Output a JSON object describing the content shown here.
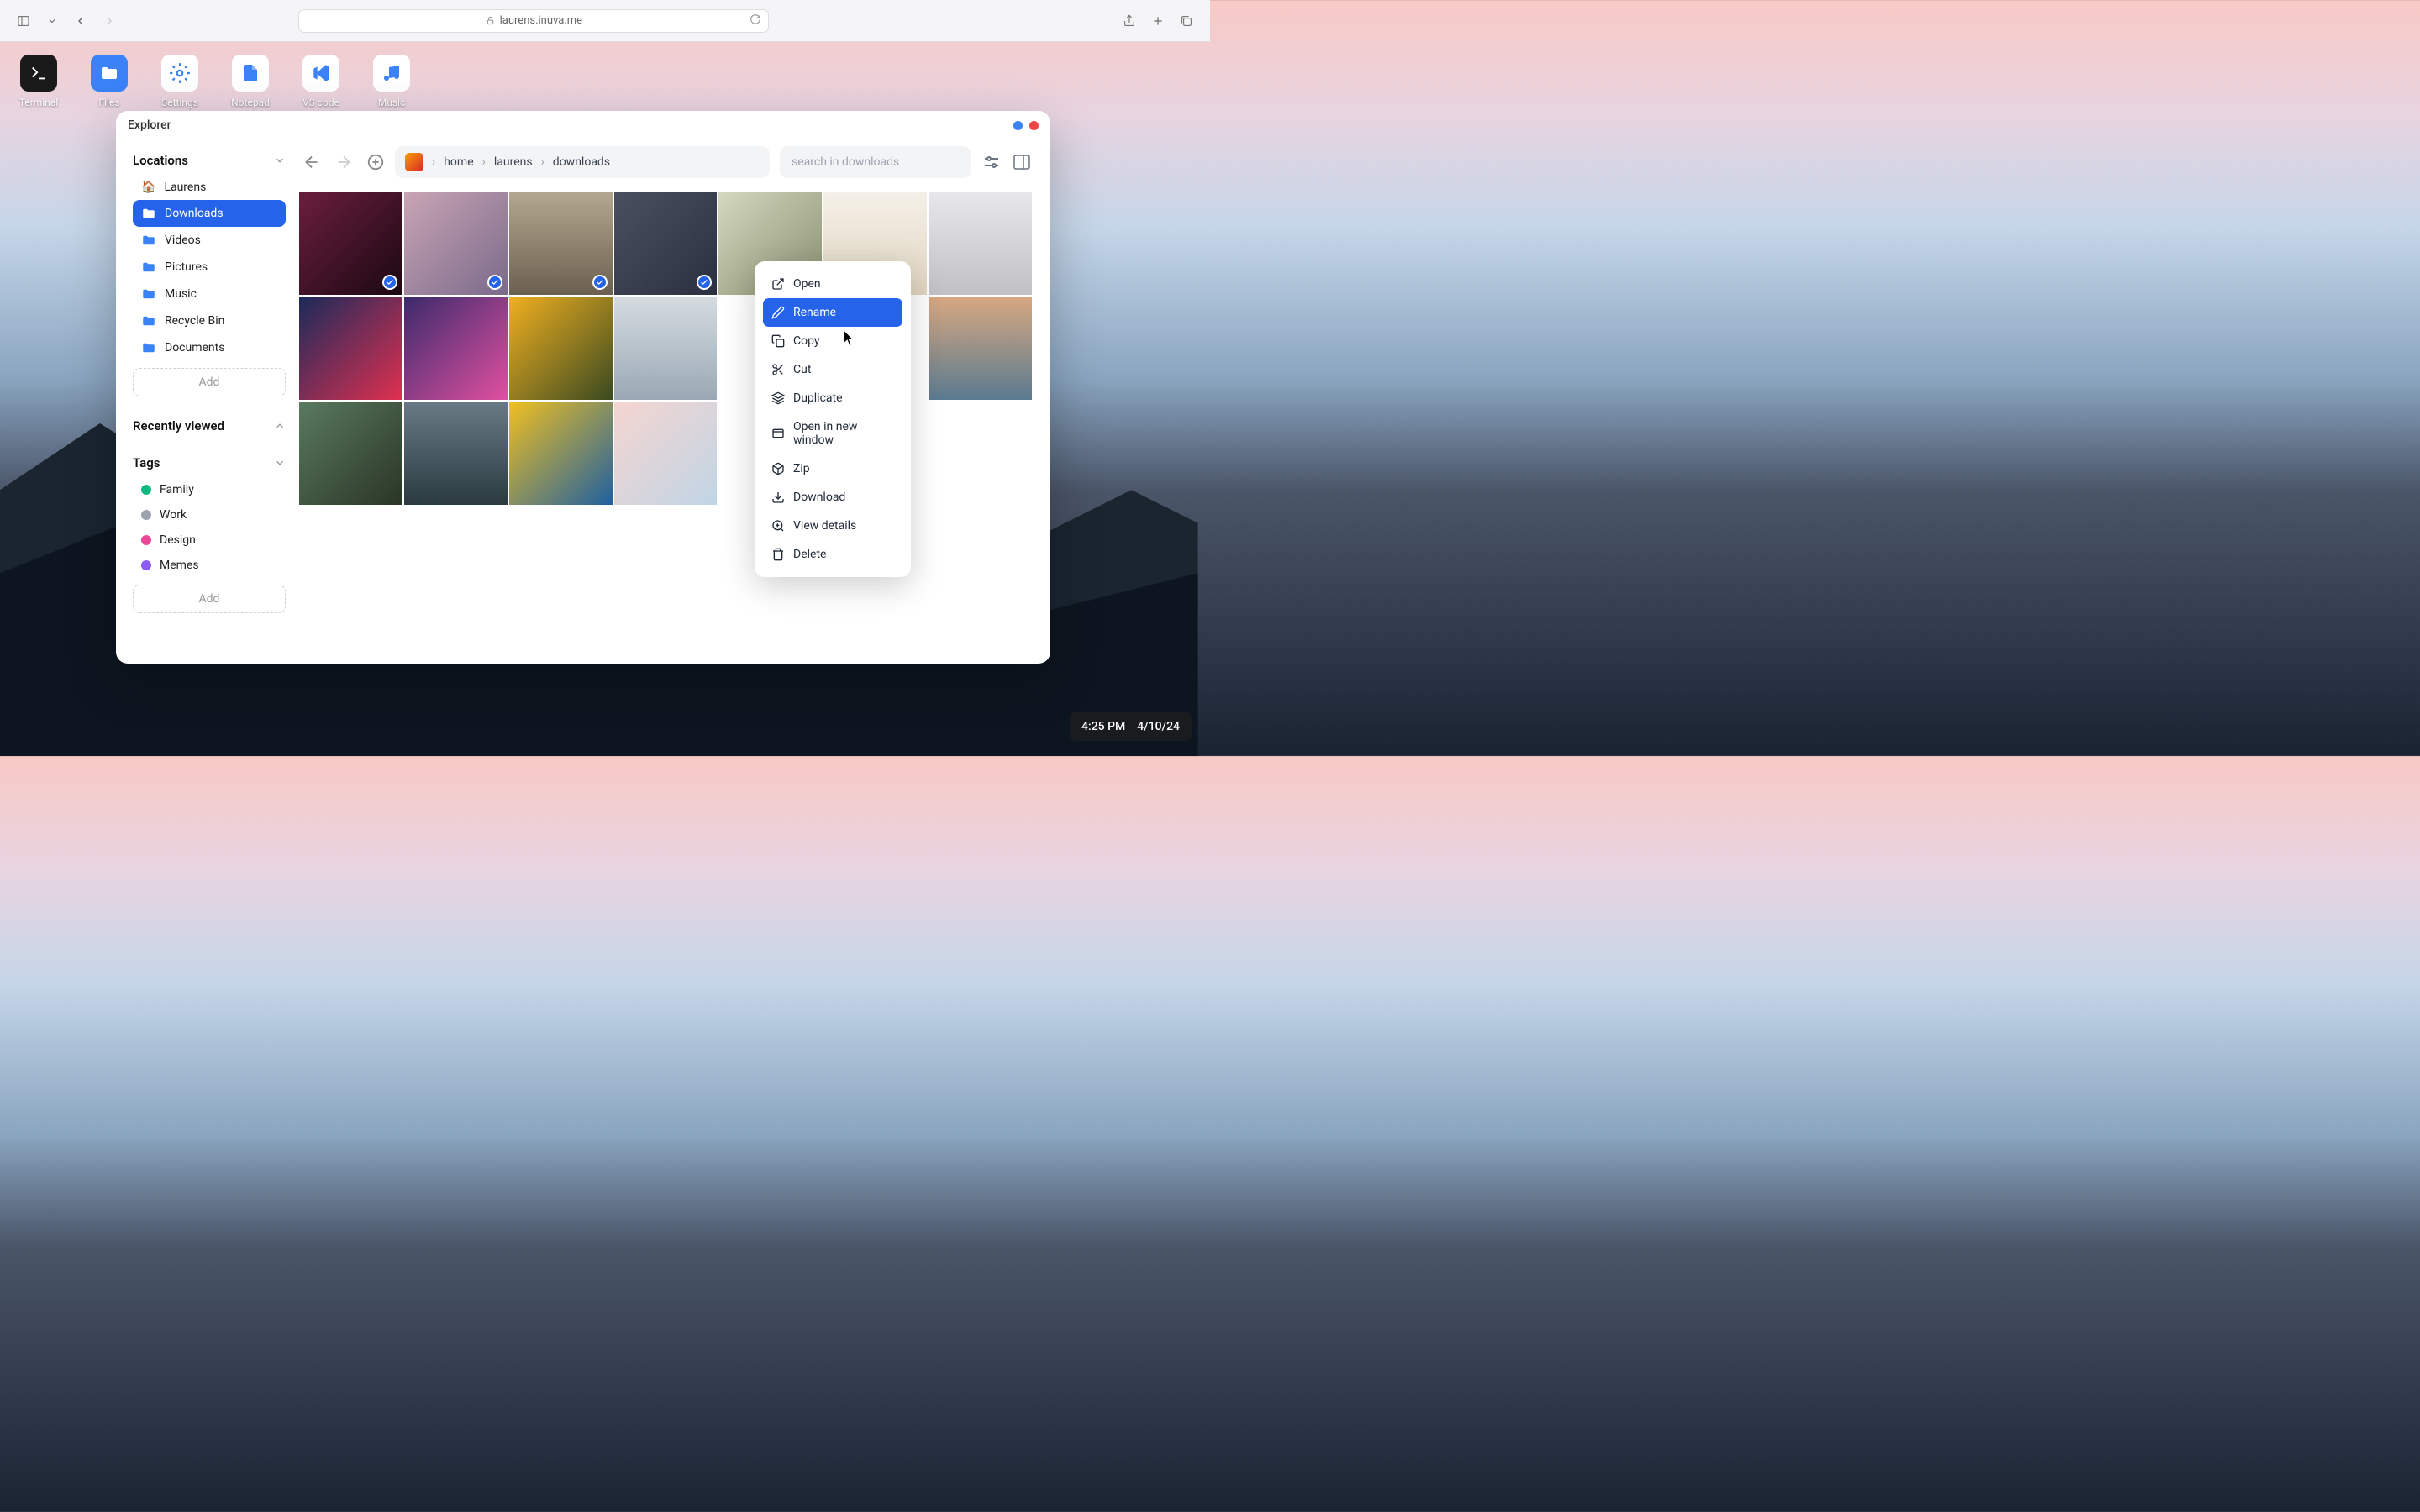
{
  "browser": {
    "url": "laurens.inuva.me"
  },
  "desktop": {
    "icons": [
      {
        "label": "Terminal",
        "bg": "dark",
        "glyph": "terminal"
      },
      {
        "label": "Files",
        "bg": "blue",
        "glyph": "folder"
      },
      {
        "label": "Settings",
        "bg": "white",
        "glyph": "gear"
      },
      {
        "label": "Notepad",
        "bg": "white",
        "glyph": "file"
      },
      {
        "label": "VS code",
        "bg": "white",
        "glyph": "vscode"
      },
      {
        "label": "Music",
        "bg": "white",
        "glyph": "music"
      }
    ]
  },
  "window": {
    "title": "Explorer",
    "controls_colors": [
      "#3b82f6",
      "#ef4444"
    ]
  },
  "sidebar": {
    "locations_header": "Locations",
    "locations": [
      {
        "label": "Laurens",
        "icon": "home"
      },
      {
        "label": "Downloads",
        "icon": "folder",
        "active": true
      },
      {
        "label": "Videos",
        "icon": "folder"
      },
      {
        "label": "Pictures",
        "icon": "folder"
      },
      {
        "label": "Music",
        "icon": "folder"
      },
      {
        "label": "Recycle Bin",
        "icon": "folder"
      },
      {
        "label": "Documents",
        "icon": "folder"
      }
    ],
    "add_label": "Add",
    "recent_header": "Recently viewed",
    "tags_header": "Tags",
    "tags": [
      {
        "label": "Family",
        "color": "#10b981"
      },
      {
        "label": "Work",
        "color": "#9ca3af"
      },
      {
        "label": "Design",
        "color": "#ec4899"
      },
      {
        "label": "Memes",
        "color": "#8b5cf6"
      }
    ]
  },
  "toolbar": {
    "breadcrumbs": [
      "home",
      "laurens",
      "downloads"
    ],
    "search_placeholder": "search in downloads"
  },
  "grid": {
    "tiles": [
      {
        "bg": "linear-gradient(135deg,#6b1e3e,#1a0812)",
        "selected": true
      },
      {
        "bg": "linear-gradient(135deg,#c9a5b5,#7a6a8a)",
        "selected": true
      },
      {
        "bg": "linear-gradient(180deg,#b5a890,#6b6050)",
        "selected": true
      },
      {
        "bg": "linear-gradient(135deg,#4a5060,#2a3040)",
        "selected": true
      },
      {
        "bg": "linear-gradient(135deg,#d4d8c0,#8a9070)",
        "selected": false
      },
      {
        "bg": "linear-gradient(180deg,#f5f0e8,#e0d5c0)",
        "selected": false
      },
      {
        "bg": "linear-gradient(180deg,#e8e8ea,#c0c0c5)",
        "selected": false
      },
      {
        "bg": "linear-gradient(135deg,#1a2a5a,#e03050)",
        "selected": false
      },
      {
        "bg": "linear-gradient(135deg,#3a2a6a,#e050a0)",
        "selected": false
      },
      {
        "bg": "linear-gradient(135deg,#f0b020,#3a4a20)",
        "selected": false
      },
      {
        "bg": "linear-gradient(180deg,#d5dce0,#9aa8b5)",
        "selected": false
      },
      {
        "bg": "#fff",
        "selected": false,
        "hidden": true
      },
      {
        "bg": "#fff",
        "selected": false,
        "hidden": true
      },
      {
        "bg": "linear-gradient(180deg,#d8a880,#5a7a90)",
        "selected": false
      },
      {
        "bg": "linear-gradient(135deg,#5a7a60,#2a3525)",
        "selected": false
      },
      {
        "bg": "linear-gradient(180deg,#6a7a85,#2a3a40)",
        "selected": false
      },
      {
        "bg": "linear-gradient(135deg,#f0c020,#2060a0)",
        "selected": false
      },
      {
        "bg": "linear-gradient(135deg,#f5d5d0,#c0d5e5)",
        "selected": false
      }
    ]
  },
  "context_menu": {
    "items": [
      {
        "label": "Open",
        "icon": "external"
      },
      {
        "label": "Rename",
        "icon": "pencil",
        "highlight": true
      },
      {
        "label": "Copy",
        "icon": "copy"
      },
      {
        "label": "Cut",
        "icon": "scissors"
      },
      {
        "label": "Duplicate",
        "icon": "layers"
      },
      {
        "label": "Open in new window",
        "icon": "window"
      },
      {
        "label": "Zip",
        "icon": "package"
      },
      {
        "label": "Download",
        "icon": "download"
      },
      {
        "label": "View details",
        "icon": "zoom"
      },
      {
        "label": "Delete",
        "icon": "trash"
      }
    ]
  },
  "taskbar": {
    "time": "4:25 PM",
    "date": "4/10/24"
  }
}
